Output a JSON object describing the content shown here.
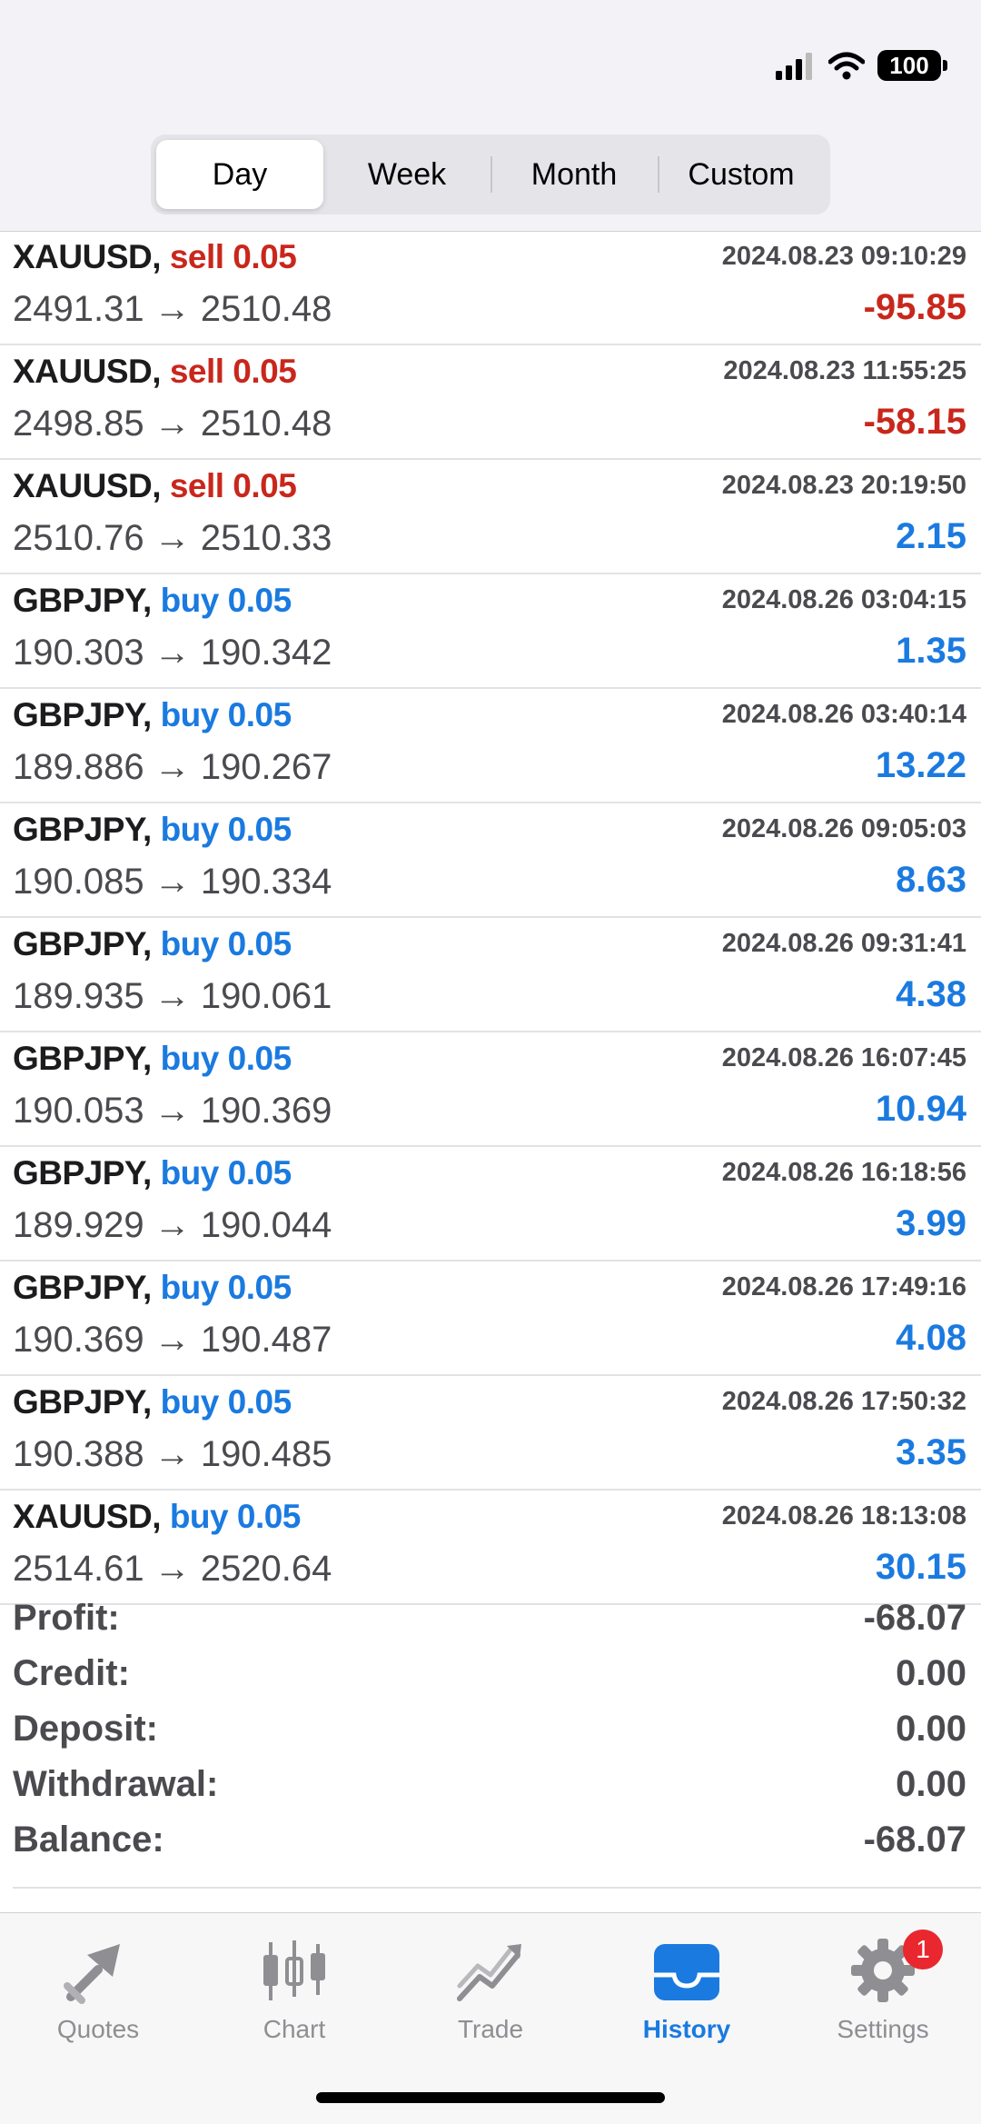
{
  "status": {
    "battery": "100"
  },
  "segments": [
    "Day",
    "Week",
    "Month",
    "Custom"
  ],
  "active_segment": "Day",
  "deals": [
    {
      "symbol": "XAUUSD,",
      "side": "sell 0.05",
      "type": "sell",
      "time": "2024.08.23 09:10:29",
      "prices": "2491.31 → 2510.48",
      "profit": "-95.85",
      "sign": "neg"
    },
    {
      "symbol": "XAUUSD,",
      "side": "sell 0.05",
      "type": "sell",
      "time": "2024.08.23 11:55:25",
      "prices": "2498.85 → 2510.48",
      "profit": "-58.15",
      "sign": "neg"
    },
    {
      "symbol": "XAUUSD,",
      "side": "sell 0.05",
      "type": "sell",
      "time": "2024.08.23 20:19:50",
      "prices": "2510.76 → 2510.33",
      "profit": "2.15",
      "sign": "pos"
    },
    {
      "symbol": "GBPJPY,",
      "side": "buy 0.05",
      "type": "buy",
      "time": "2024.08.26 03:04:15",
      "prices": "190.303 → 190.342",
      "profit": "1.35",
      "sign": "pos"
    },
    {
      "symbol": "GBPJPY,",
      "side": "buy 0.05",
      "type": "buy",
      "time": "2024.08.26 03:40:14",
      "prices": "189.886 → 190.267",
      "profit": "13.22",
      "sign": "pos"
    },
    {
      "symbol": "GBPJPY,",
      "side": "buy 0.05",
      "type": "buy",
      "time": "2024.08.26 09:05:03",
      "prices": "190.085 → 190.334",
      "profit": "8.63",
      "sign": "pos"
    },
    {
      "symbol": "GBPJPY,",
      "side": "buy 0.05",
      "type": "buy",
      "time": "2024.08.26 09:31:41",
      "prices": "189.935 → 190.061",
      "profit": "4.38",
      "sign": "pos"
    },
    {
      "symbol": "GBPJPY,",
      "side": "buy 0.05",
      "type": "buy",
      "time": "2024.08.26 16:07:45",
      "prices": "190.053 → 190.369",
      "profit": "10.94",
      "sign": "pos"
    },
    {
      "symbol": "GBPJPY,",
      "side": "buy 0.05",
      "type": "buy",
      "time": "2024.08.26 16:18:56",
      "prices": "189.929 → 190.044",
      "profit": "3.99",
      "sign": "pos"
    },
    {
      "symbol": "GBPJPY,",
      "side": "buy 0.05",
      "type": "buy",
      "time": "2024.08.26 17:49:16",
      "prices": "190.369 → 190.487",
      "profit": "4.08",
      "sign": "pos"
    },
    {
      "symbol": "GBPJPY,",
      "side": "buy 0.05",
      "type": "buy",
      "time": "2024.08.26 17:50:32",
      "prices": "190.388 → 190.485",
      "profit": "3.35",
      "sign": "pos"
    },
    {
      "symbol": "XAUUSD,",
      "side": "buy 0.05",
      "type": "buy",
      "time": "2024.08.26 18:13:08",
      "prices": "2514.61 → 2520.64",
      "profit": "30.15",
      "sign": "pos"
    }
  ],
  "summary": [
    {
      "label": "Profit:",
      "value": "-68.07"
    },
    {
      "label": "Credit:",
      "value": "0.00"
    },
    {
      "label": "Deposit:",
      "value": "0.00"
    },
    {
      "label": "Withdrawal:",
      "value": "0.00"
    },
    {
      "label": "Balance:",
      "value": "-68.07"
    }
  ],
  "tabs": [
    {
      "label": "Quotes",
      "icon": "quotes-icon"
    },
    {
      "label": "Chart",
      "icon": "chart-icon"
    },
    {
      "label": "Trade",
      "icon": "trade-icon"
    },
    {
      "label": "History",
      "icon": "history-icon"
    },
    {
      "label": "Settings",
      "icon": "gear-icon"
    }
  ],
  "active_tab": "History",
  "settings_badge": "1",
  "colors": {
    "sell": "#c9271c",
    "buy": "#1a7ae0",
    "active_tab": "#1a7ae0",
    "badge": "#e8282e"
  }
}
